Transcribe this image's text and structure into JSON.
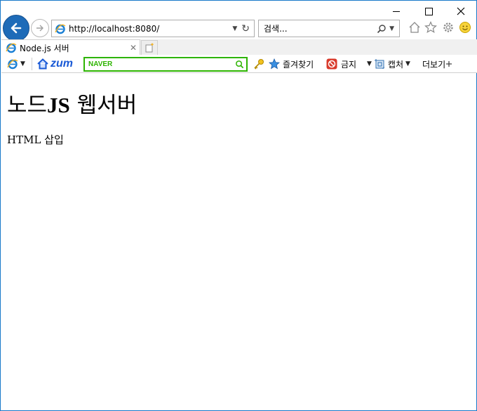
{
  "window": {
    "tab_title": "Node.js 서버"
  },
  "nav": {
    "address_url": "http://localhost:8080/",
    "search_placeholder": "검색..."
  },
  "toolbar": {
    "zum_label": "zum",
    "naver_label": "NAVER",
    "favorites_label": "즐겨찾기",
    "block_label": "금지",
    "capture_label": "캡처",
    "more_label": "더보기"
  },
  "page": {
    "heading_prefix": "노드",
    "heading_bold": "JS",
    "heading_suffix": " 웹서버",
    "paragraph": "HTML 삽입"
  },
  "colors": {
    "window_border": "#1979ca",
    "back_button": "#1e6bb8",
    "naver_green": "#2db400",
    "zum_blue": "#1a5ad6"
  }
}
